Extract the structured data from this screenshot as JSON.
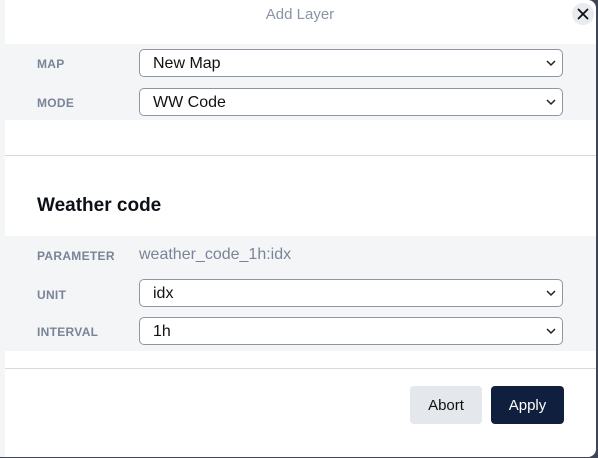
{
  "dialog": {
    "title": "Add Layer",
    "close_icon": "close-icon"
  },
  "map_section": {
    "map_label": "MAP",
    "map_value": "New Map",
    "mode_label": "MODE",
    "mode_value": "WW Code"
  },
  "layer_section": {
    "heading": "Weather code",
    "parameter_label": "PARAMETER",
    "parameter_value": "weather_code_1h:idx",
    "unit_label": "UNIT",
    "unit_value": "idx",
    "interval_label": "INTERVAL",
    "interval_value": "1h"
  },
  "footer": {
    "abort_label": "Abort",
    "apply_label": "Apply"
  },
  "colors": {
    "primary": "#0f1f3d",
    "secondary": "#e4e7eb",
    "label": "#7a8497",
    "band": "#f4f5f7"
  }
}
